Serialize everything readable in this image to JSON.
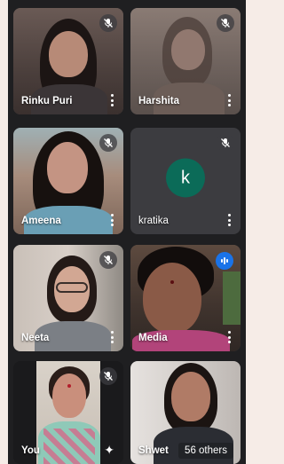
{
  "meeting": {
    "participants": [
      {
        "name": "Rinku Puri",
        "mic": "muted"
      },
      {
        "name": "Harshita",
        "mic": "muted"
      },
      {
        "name": "Ameena",
        "mic": "muted"
      },
      {
        "name": "kratika",
        "mic": "muted",
        "avatar_letter": "k",
        "avatar_color": "#0b6b58"
      },
      {
        "name": "Neeta",
        "mic": "muted"
      },
      {
        "name": "Media",
        "mic": "speaking"
      },
      {
        "name": "You",
        "mic": "muted"
      },
      {
        "name": "Shwet",
        "others_label": "56 others"
      }
    ]
  },
  "colors": {
    "background": "#f6ece7",
    "grid": "#1f1f21",
    "speaking": "#1a73e8"
  },
  "icons": {
    "muted": "mic-off-icon",
    "speaking": "audio-levels-icon",
    "menu": "more-vert-icon",
    "effects": "sparkle-effects-icon"
  }
}
